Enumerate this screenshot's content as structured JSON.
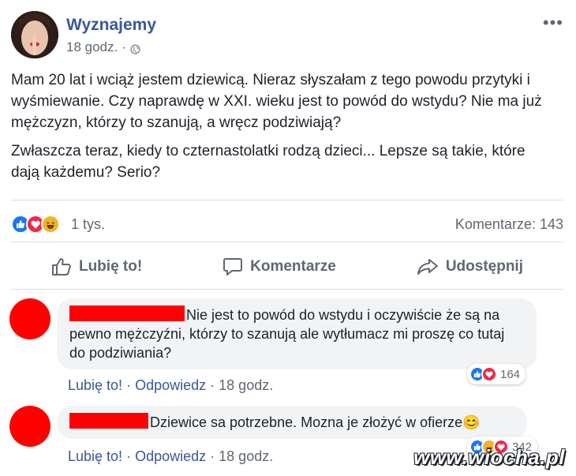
{
  "post": {
    "page_name": "Wyznajemy",
    "time": "18 godz.",
    "separator": "·",
    "more_icon": "more-dots-icon",
    "paragraphs": [
      "Mam 20 lat i wciąż jestem dziewicą. Nieraz słyszałam z tego powodu przytyki i wyśmiewanie. Czy naprawdę w XXI. wieku jest to powód do wstydu? Nie ma już mężczyzn, którzy to szanują, a wręcz podziwiają?",
      "Zwłaszcza teraz, kiedy to czternastolatki rodzą dzieci... Lepsze są takie, które dają każdemu? Serio?"
    ]
  },
  "reactions": {
    "count": "1 tys.",
    "comments": "Komentarze: 143",
    "icons": [
      "like-icon",
      "love-icon",
      "haha-icon"
    ]
  },
  "actions": {
    "like": "Lubię to!",
    "comment": "Komentarze",
    "share": "Udostępnij"
  },
  "comments": [
    {
      "text": "Nie jest to powód do wstydu i oczywiście że są na pewno mężczyźni, którzy to szanują ale wytłumacz mi proszę co tutaj do podziwiania?",
      "like": "Lubię to!",
      "reply": "Odpowiedz",
      "time": "18 godz.",
      "reaction_count": "164"
    },
    {
      "text": "Dziewice sa potrzebne. Mozna je złożyć w ofierze",
      "emoji": "😊",
      "like": "Lubię to!",
      "reply": "Odpowiedz",
      "time": "18 godz.",
      "reaction_count": "342"
    }
  ],
  "watermark": "www.wiocha.pl",
  "colors": {
    "link": "#385898",
    "meta": "#606770",
    "redaction": "#ff0000",
    "like": "#1877f2",
    "love": "#f0284a",
    "haha": "#f7b125"
  }
}
